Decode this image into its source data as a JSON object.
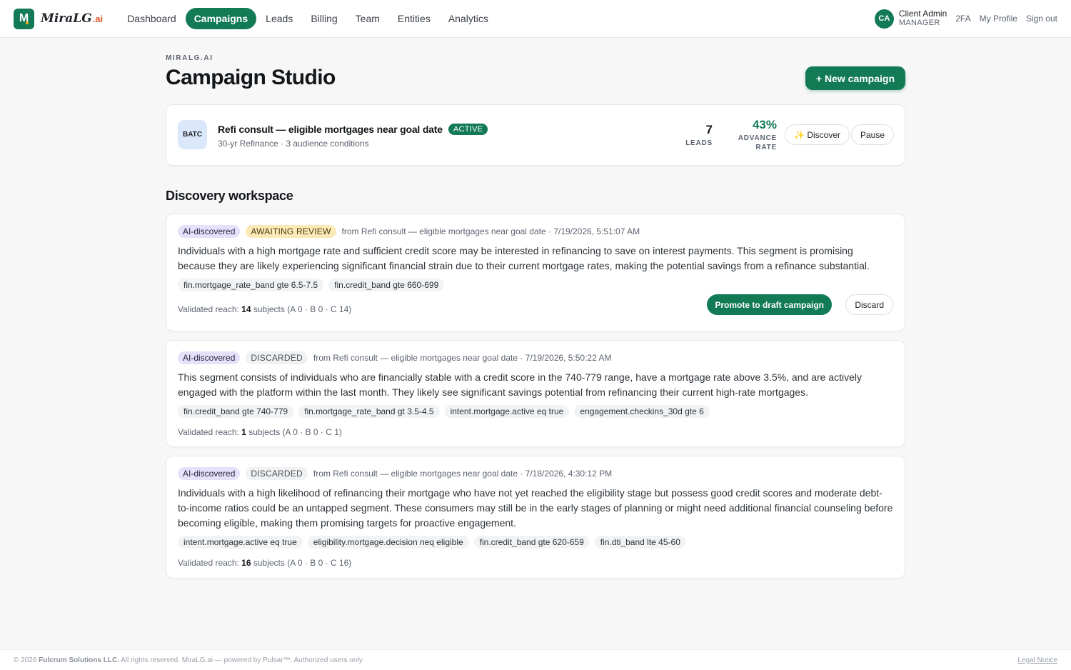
{
  "brand": {
    "mark": "M",
    "name": "MiraLG",
    "suffix": ".ai"
  },
  "nav": {
    "items": [
      "Dashboard",
      "Campaigns",
      "Leads",
      "Billing",
      "Team",
      "Entities",
      "Analytics"
    ],
    "active": "Campaigns"
  },
  "user": {
    "initials": "CA",
    "name": "Client Admin",
    "role": "MANAGER",
    "twofa": "2FA",
    "profile": "My Profile",
    "signout": "Sign out"
  },
  "page": {
    "eyebrow": "MIRALG.AI",
    "title": "Campaign Studio",
    "new_button": "+ New campaign"
  },
  "campaign": {
    "code": "BATC",
    "title": "Refi consult — eligible mortgages near goal date",
    "status": "ACTIVE",
    "subtitle": "30-yr Refinance · 3 audience conditions",
    "leads_value": "7",
    "leads_label": "LEADS",
    "rate_value": "43%",
    "rate_label_1": "ADVANCE",
    "rate_label_2": "RATE",
    "discover_label": "✨ Discover",
    "pause_label": "Pause"
  },
  "discovery": {
    "title": "Discovery workspace",
    "items": [
      {
        "tag": "AI-discovered",
        "status": "AWAITING REVIEW",
        "source": "from Refi consult — eligible mortgages near goal date · 7/19/2026, 5:51:07 AM",
        "body": "Individuals with a high mortgage rate and sufficient credit score may be interested in refinancing to save on interest payments. This segment is promising because they are likely experiencing significant financial strain due to their current mortgage rates, making the potential savings from a refinance substantial.",
        "chips": [
          "fin.mortgage_rate_band gte 6.5-7.5",
          "fin.credit_band gte 660-699"
        ],
        "reach_prefix": "Validated reach: ",
        "reach_count": "14",
        "reach_suffix": " subjects (A 0 · B 0 · C 14)",
        "promote_label": "Promote to draft campaign",
        "discard_label": "Discard"
      },
      {
        "tag": "AI-discovered",
        "status": "DISCARDED",
        "source": "from Refi consult — eligible mortgages near goal date · 7/19/2026, 5:50:22 AM",
        "body": "This segment consists of individuals who are financially stable with a credit score in the 740-779 range, have a mortgage rate above 3.5%, and are actively engaged with the platform within the last month. They likely see significant savings potential from refinancing their current high-rate mortgages.",
        "chips": [
          "fin.credit_band gte 740-779",
          "fin.mortgage_rate_band gt 3.5-4.5",
          "intent.mortgage.active eq true",
          "engagement.checkins_30d gte 6"
        ],
        "reach_prefix": "Validated reach: ",
        "reach_count": "1",
        "reach_suffix": " subjects (A 0 · B 0 · C 1)"
      },
      {
        "tag": "AI-discovered",
        "status": "DISCARDED",
        "source": "from Refi consult — eligible mortgages near goal date · 7/18/2026, 4:30:12 PM",
        "body": "Individuals with a high likelihood of refinancing their mortgage who have not yet reached the eligibility stage but possess good credit scores and moderate debt-to-income ratios could be an untapped segment. These consumers may still be in the early stages of planning or might need additional financial counseling before becoming eligible, making them promising targets for proactive engagement.",
        "chips": [
          "intent.mortgage.active eq true",
          "eligibility.mortgage.decision neq eligible",
          "fin.credit_band gte 620-659",
          "fin.dti_band lte 45-60"
        ],
        "reach_prefix": "Validated reach: ",
        "reach_count": "16",
        "reach_suffix": " subjects (A 0 · B 0 · C 16)"
      }
    ]
  },
  "footer": {
    "prefix": "© 2026 ",
    "company": "Fulcrum Solutions LLC.",
    "suffix": " All rights reserved. MiraLG.ai — powered by Pulsar™. Authorized users only.",
    "legal": "Legal Notice"
  },
  "colors": {
    "brand": "#127a55",
    "accent": "#e2582a",
    "ai_tag": "#e6e1fb",
    "await_tag": "#fbe9b8"
  }
}
